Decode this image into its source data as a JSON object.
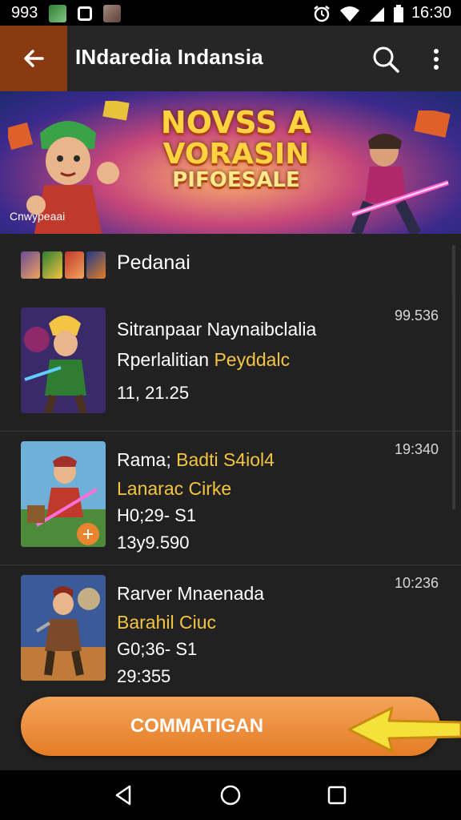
{
  "status_bar": {
    "left_text": "993",
    "time": "16:30",
    "icons": [
      "app-thumbnail-green",
      "square-icon",
      "photo-thumbnail",
      "alarm-icon",
      "wifi-icon",
      "signal-icon",
      "battery-icon"
    ]
  },
  "app_bar": {
    "title": "INdaredia Indansia",
    "back_icon": "back-arrow-icon",
    "search_icon": "search-icon",
    "more_icon": "more-vert-icon",
    "back_bg": "#8a3a10"
  },
  "banner": {
    "line1": "NOVSS A",
    "line2": "VORASIN",
    "line3": "PIFOESALE",
    "watermark": "Cnwypeaai"
  },
  "section": {
    "title": "Pedanai"
  },
  "games": [
    {
      "name": "Sitranpaar Naynaibclalia",
      "sub_plain": "Rperlalitian ",
      "sub_highlight": "Peyddalc",
      "meta1": "11, 21.25",
      "meta2": "",
      "time": "99.536"
    },
    {
      "name_plain": "Rama; ",
      "name_highlight": "Badti S4iol4",
      "sub_highlight": "Lanarac Cirke",
      "meta1": "H0;29- S1",
      "meta2": "13y9.590",
      "time": "19:340"
    },
    {
      "name": "Rarver Mnaenada",
      "sub_highlight": "Barahil Ciuc",
      "meta1": "G0;36- S1",
      "meta2": "29:355",
      "time": "10:236"
    }
  ],
  "cta": {
    "label": "COMMATIGAN"
  },
  "nav": {
    "back_icon": "nav-back-icon",
    "home_icon": "nav-home-icon",
    "recents_icon": "nav-recents-icon"
  },
  "colors": {
    "accent": "#f4c542",
    "cta": "#e8852e",
    "background": "#212121"
  }
}
